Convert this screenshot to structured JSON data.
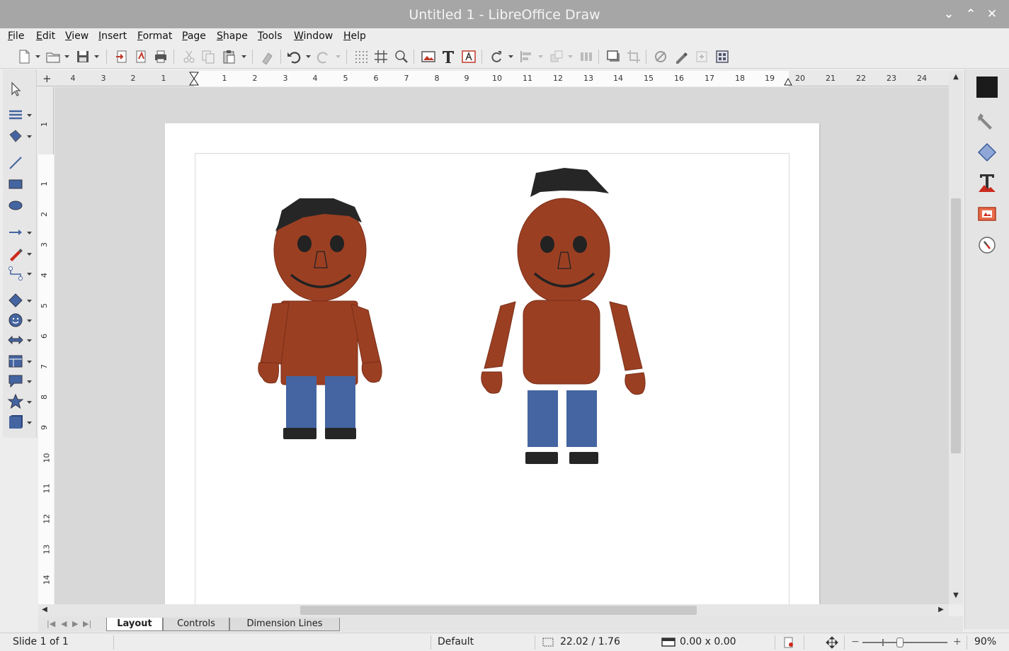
{
  "window": {
    "title": "Untitled 1 - LibreOffice Draw",
    "minimize_glyph": "⌄",
    "maximize_glyph": "⌃",
    "close_glyph": "✕"
  },
  "menu": [
    "File",
    "Edit",
    "View",
    "Insert",
    "Format",
    "Page",
    "Shape",
    "Tools",
    "Window",
    "Help"
  ],
  "toolbar": {
    "icons": [
      "new-document-icon",
      "open-icon",
      "save-icon",
      "export-icon",
      "export-pdf-icon",
      "print-icon",
      "cut-icon",
      "copy-icon",
      "paste-icon",
      "clone-formatting-icon",
      "undo-icon",
      "redo-icon",
      "grid-icon",
      "helplines-icon",
      "zoom-icon",
      "image-icon",
      "text-icon",
      "fontwork-icon",
      "rotate-icon",
      "align-icon",
      "arrange-icon",
      "distribute-icon",
      "shadow-icon",
      "crop-icon",
      "filter-icon",
      "points-icon",
      "glue-points-icon",
      "toggle-extrusion-icon"
    ]
  },
  "ruler": {
    "h_left": [
      "4",
      "3",
      "2",
      "1"
    ],
    "h_right": [
      "1",
      "2",
      "3",
      "4",
      "5",
      "6",
      "7",
      "8",
      "9",
      "10",
      "11",
      "12",
      "13",
      "14",
      "15",
      "16",
      "17",
      "18",
      "19",
      "20",
      "21",
      "22",
      "23",
      "24"
    ],
    "v_top": [
      "1"
    ],
    "v_bottom": [
      "1",
      "2",
      "3",
      "4",
      "5",
      "6",
      "7",
      "8",
      "9",
      "10",
      "11",
      "12",
      "13",
      "14"
    ]
  },
  "left_tools": [
    "select-icon",
    "line-color-icon",
    "fill-color-icon",
    "line-icon",
    "rectangle-icon",
    "ellipse-icon",
    "lines-arrows-icon",
    "curve-icon",
    "connector-icon",
    "basic-shapes-icon",
    "symbol-shapes-icon",
    "block-arrows-icon",
    "flowchart-icon",
    "callouts-icon",
    "stars-icon",
    "3d-objects-icon"
  ],
  "sidebar": [
    "properties-icon",
    "styles-icon",
    "gallery-icon",
    "shapes-icon",
    "navigator-icon",
    "compass-icon"
  ],
  "tabs": [
    "Layout",
    "Controls",
    "Dimension Lines"
  ],
  "active_tab": "Layout",
  "status": {
    "slide": "Slide 1 of 1",
    "master": "Default",
    "position": "22.02 / 1.76",
    "size": "0.00 x 0.00",
    "zoom": "90%"
  },
  "colors": {
    "skin": "#9b3f23",
    "hair": "#262626",
    "pants": "#4465a1",
    "shoes": "#262626",
    "eyes": "#222222",
    "accent_red": "#cc2a1e"
  }
}
